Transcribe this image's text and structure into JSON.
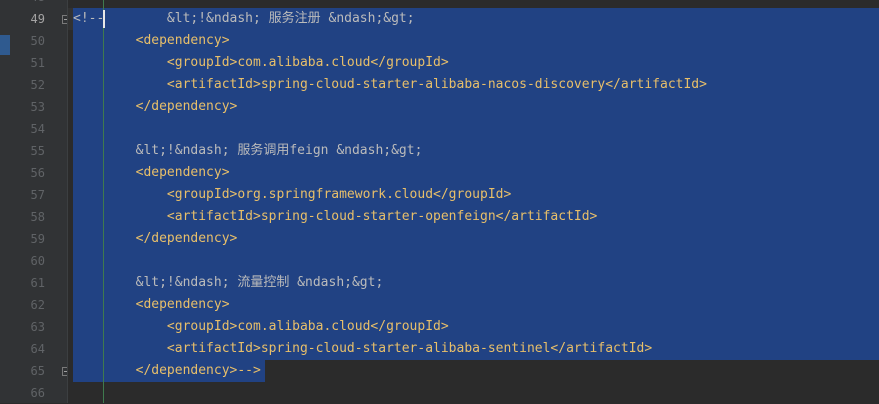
{
  "gutter": {
    "partial_top": "48",
    "line_numbers": [
      "49",
      "50",
      "51",
      "52",
      "53",
      "54",
      "55",
      "56",
      "57",
      "58",
      "59",
      "60",
      "61",
      "62",
      "63",
      "64",
      "65",
      "66"
    ],
    "current_line": "49"
  },
  "code": {
    "lines": [
      "<!--        &lt;!&ndash; 服务注册 &ndash;&gt;",
      "        <dependency>",
      "            <groupId>com.alibaba.cloud</groupId>",
      "            <artifactId>spring-cloud-starter-alibaba-nacos-discovery</artifactId>",
      "        </dependency>",
      "",
      "        &lt;!&ndash; 服务调用feign &ndash;&gt;",
      "        <dependency>",
      "            <groupId>org.springframework.cloud</groupId>",
      "            <artifactId>spring-cloud-starter-openfeign</artifactId>",
      "        </dependency>",
      "",
      "        &lt;!&ndash; 流量控制 &ndash;&gt;",
      "        <dependency>",
      "            <groupId>com.alibaba.cloud</groupId>",
      "            <artifactId>spring-cloud-starter-alibaba-sentinel</artifactId>",
      "        </dependency>-->",
      ""
    ]
  },
  "colors": {
    "background": "#2b2b2b",
    "gutter": "#313335",
    "selection": "#214283",
    "tag": "#e8bf6a",
    "text": "#bbbbbb"
  }
}
